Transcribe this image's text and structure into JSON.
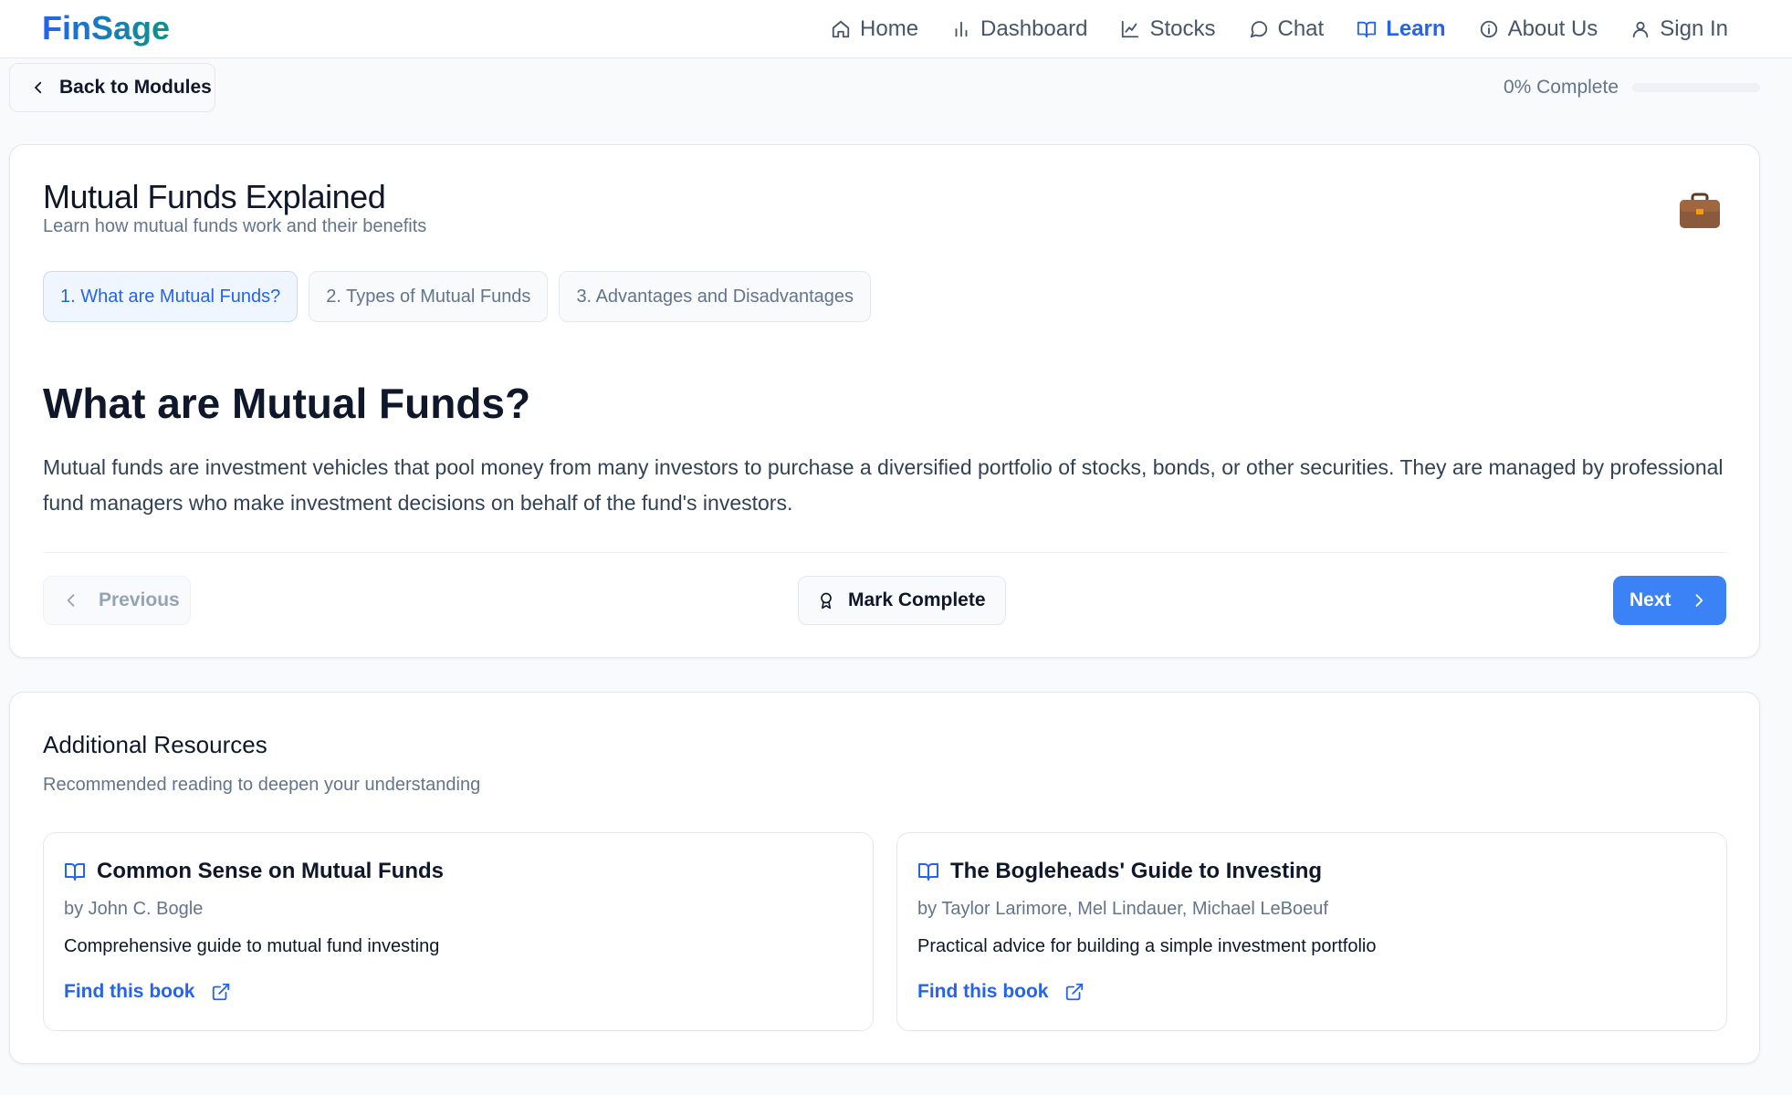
{
  "app": {
    "logo": "FinSage"
  },
  "nav": [
    {
      "label": "Home",
      "icon": "home-icon"
    },
    {
      "label": "Dashboard",
      "icon": "bar-chart-icon"
    },
    {
      "label": "Stocks",
      "icon": "line-chart-icon"
    },
    {
      "label": "Chat",
      "icon": "chat-bubble-icon"
    },
    {
      "label": "Learn",
      "icon": "book-open-icon",
      "active": true
    },
    {
      "label": "About Us",
      "icon": "info-icon"
    },
    {
      "label": "Sign In",
      "icon": "user-icon"
    }
  ],
  "subbar": {
    "back_label": "Back to Modules",
    "progress_label": "0% Complete",
    "progress_value": 0
  },
  "module": {
    "title": "Mutual Funds Explained",
    "subtitle": "Learn how mutual funds work and their benefits",
    "icon": "briefcase-icon",
    "tabs": [
      {
        "label": "1. What are Mutual Funds?",
        "active": true
      },
      {
        "label": "2. Types of Mutual Funds",
        "active": false
      },
      {
        "label": "3. Advantages and Disadvantages",
        "active": false
      }
    ],
    "section_title": "What are Mutual Funds?",
    "section_body": "Mutual funds are investment vehicles that pool money from many investors to purchase a diversified portfolio of stocks, bonds, or other securities. They are managed by professional fund managers who make investment decisions on behalf of the fund's investors.",
    "prev_label": "Previous",
    "mark_label": "Mark Complete",
    "next_label": "Next"
  },
  "resources": {
    "title": "Additional Resources",
    "subtitle": "Recommended reading to deepen your understanding",
    "books": [
      {
        "title": "Common Sense on Mutual Funds",
        "author": "by John C. Bogle",
        "description": "Comprehensive guide to mutual fund investing",
        "link_label": "Find this book"
      },
      {
        "title": "The Bogleheads' Guide to Investing",
        "author": "by Taylor Larimore, Mel Lindauer, Michael LeBoeuf",
        "description": "Practical advice for building a simple investment portfolio",
        "link_label": "Find this book"
      }
    ]
  },
  "colors": {
    "accent": "#2563eb",
    "next_button": "#3b82f6",
    "background": "#f8fafc"
  }
}
